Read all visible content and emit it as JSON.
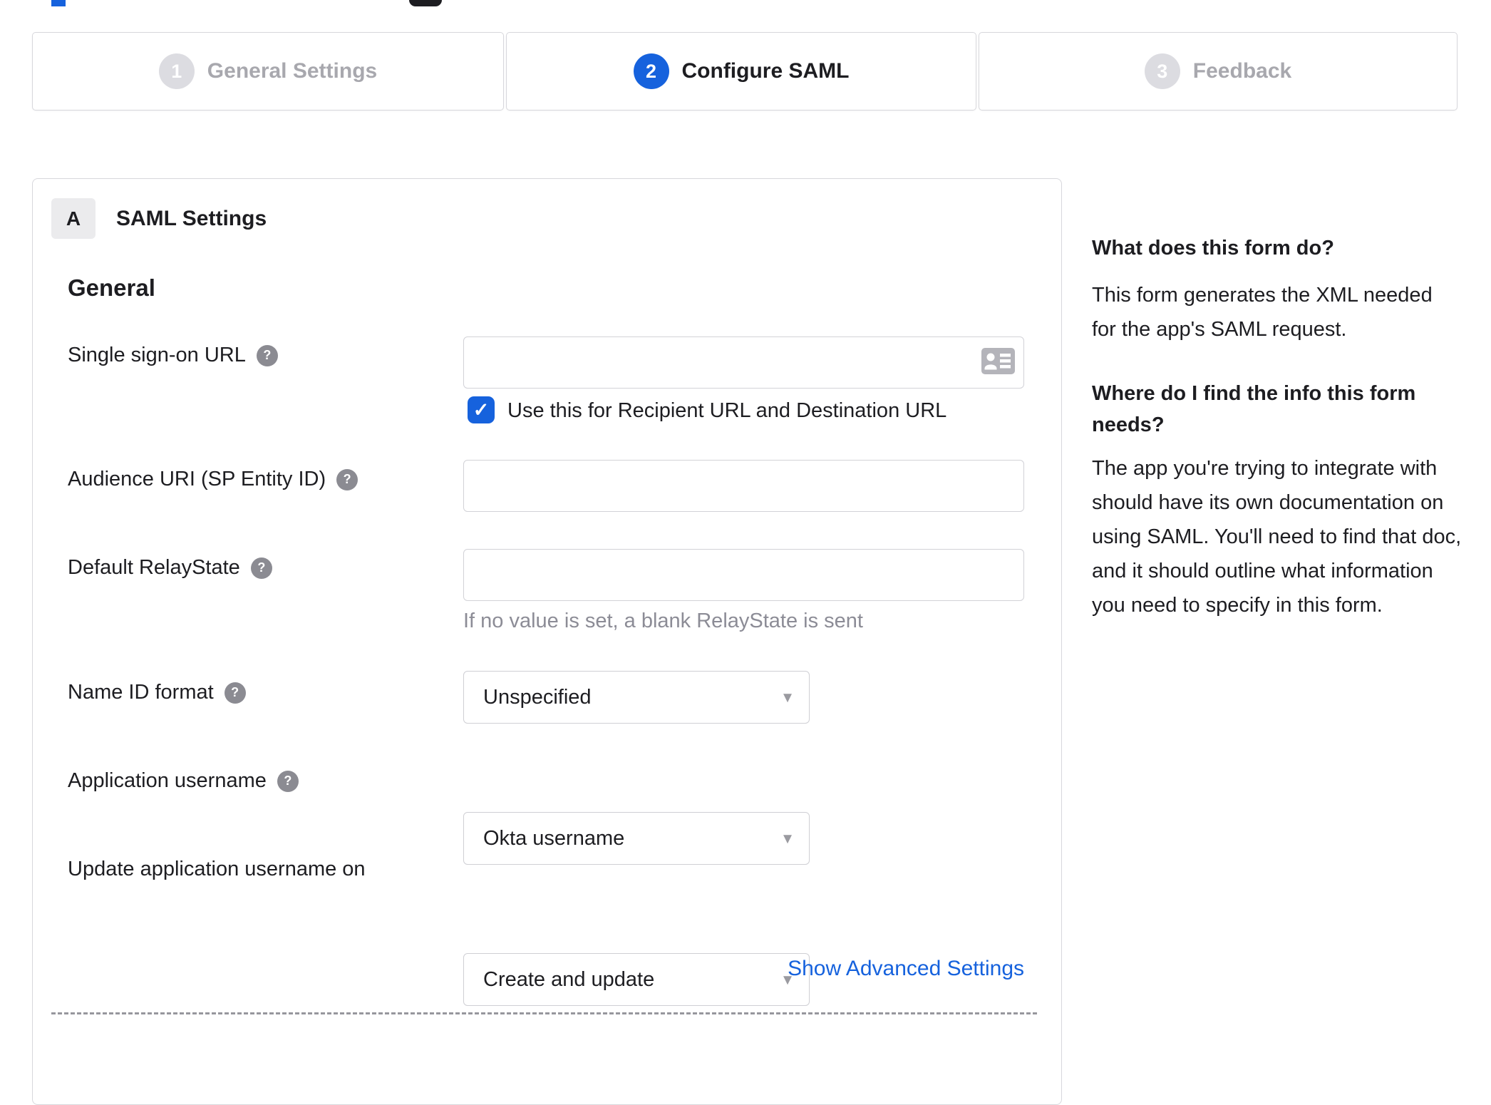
{
  "stepper": {
    "steps": [
      {
        "number": "1",
        "label": "General Settings"
      },
      {
        "number": "2",
        "label": "Configure SAML"
      },
      {
        "number": "3",
        "label": "Feedback"
      }
    ]
  },
  "panel": {
    "badge": "A",
    "title": "SAML Settings",
    "heading": "General",
    "sso": {
      "label": "Single sign-on URL",
      "value": "",
      "checkbox_label": "Use this for Recipient URL and Destination URL",
      "checkbox_checked": true
    },
    "audience": {
      "label": "Audience URI (SP Entity ID)",
      "value": ""
    },
    "relay": {
      "label": "Default RelayState",
      "value": "",
      "hint": "If no value is set, a blank RelayState is sent"
    },
    "name_id": {
      "label": "Name ID format",
      "value": "Unspecified"
    },
    "app_user": {
      "label": "Application username",
      "value": "Okta username"
    },
    "update_user": {
      "label": "Update application username on",
      "value": "Create and update"
    },
    "advanced_link": "Show Advanced Settings"
  },
  "help": {
    "q1": "What does this form do?",
    "a1": "This form generates the XML needed for the app's SAML request.",
    "q2": "Where do I find the info this form needs?",
    "a2": "The app you're trying to integrate with should have its own documentation on using SAML. You'll need to find that doc, and it should outline what information you need to specify in this form."
  },
  "colors": {
    "accent_blue": "#1662dd",
    "text_dark": "#1d1d21",
    "inactive_gray": "#a8a8ae",
    "border_gray": "#d7d7dc"
  }
}
